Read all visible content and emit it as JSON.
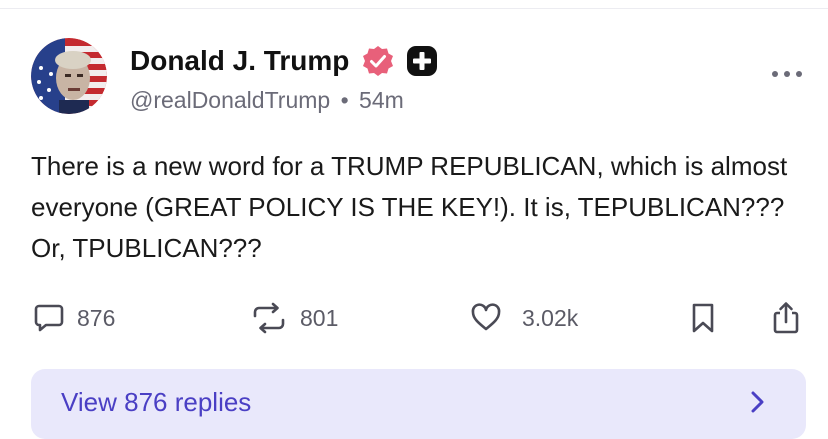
{
  "post": {
    "author": {
      "display_name": "Donald J. Trump",
      "handle": "@realDonaldTrump",
      "separator": "•",
      "time_ago": "54m",
      "verified_icon": "verified-badge-icon",
      "plus_icon": "plus-badge-icon",
      "avatar": "avatar"
    },
    "text": "There is a new word for a TRUMP REPUBLICAN, which is almost everyone (GREAT POLICY IS THE KEY!). It is, TEPUBLICAN??? Or, TPUBLICAN???",
    "actions": {
      "replies_count": "876",
      "reposts_count": "801",
      "likes_count": "3.02k"
    },
    "view_replies_label": "View 876 replies"
  },
  "colors": {
    "accent": "#4a3fc4",
    "replies_bar_bg": "#e9e8fb",
    "verified": "#e8607a",
    "muted_text": "#6b6b78"
  }
}
